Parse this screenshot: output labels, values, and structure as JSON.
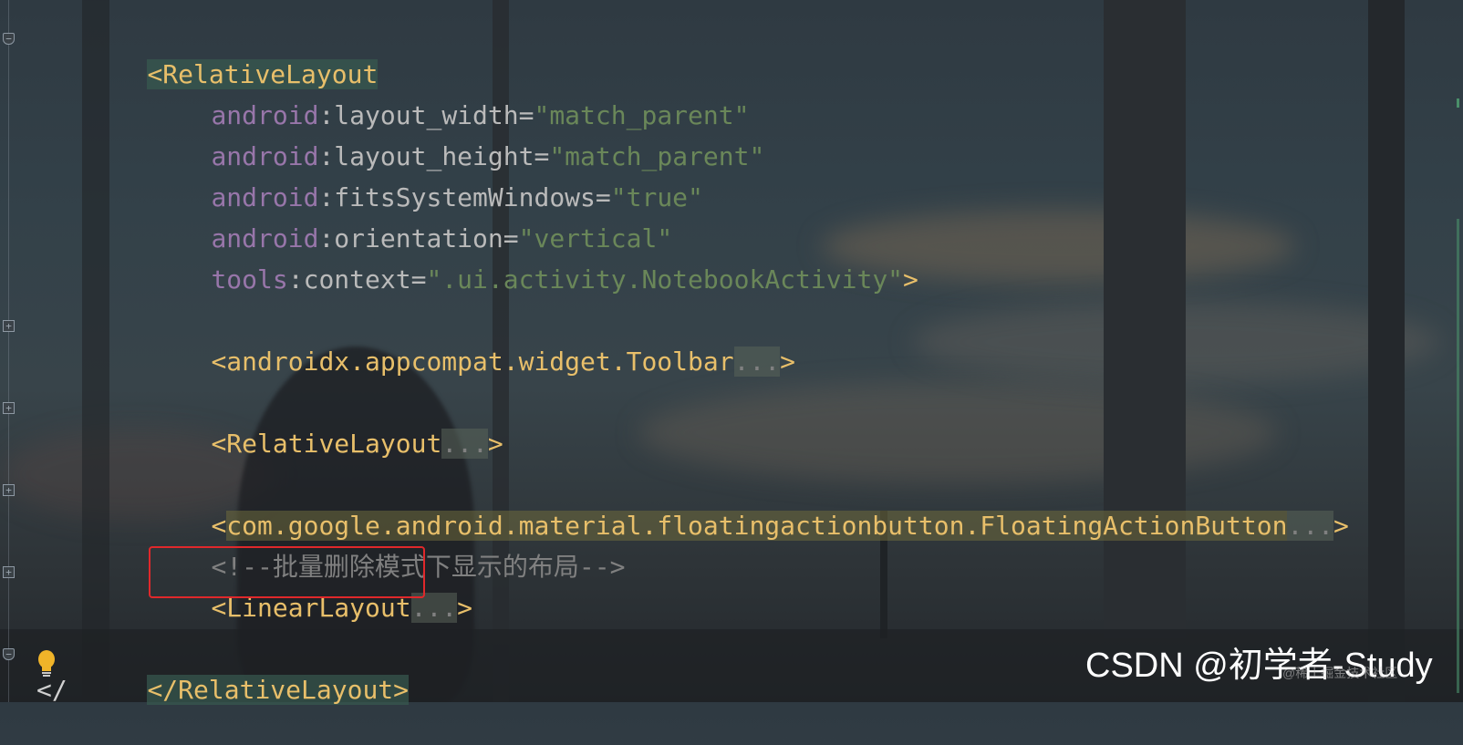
{
  "editor": {
    "lines": [
      {
        "id": "l1",
        "parts": [
          {
            "t": "<",
            "c": "tag"
          },
          {
            "t": "RelativeLayout",
            "c": "tag"
          }
        ]
      },
      {
        "id": "l2",
        "parts": [
          {
            "t": "android",
            "c": "ns"
          },
          {
            "t": ":layout_width",
            "c": "attr"
          },
          {
            "t": "=",
            "c": "attr"
          },
          {
            "t": "\"match_parent\"",
            "c": "val"
          }
        ]
      },
      {
        "id": "l3",
        "parts": [
          {
            "t": "android",
            "c": "ns"
          },
          {
            "t": ":layout_height",
            "c": "attr"
          },
          {
            "t": "=",
            "c": "attr"
          },
          {
            "t": "\"match_parent\"",
            "c": "val"
          }
        ]
      },
      {
        "id": "l4",
        "parts": [
          {
            "t": "android",
            "c": "ns"
          },
          {
            "t": ":fitsSystemWindows",
            "c": "attr"
          },
          {
            "t": "=",
            "c": "attr"
          },
          {
            "t": "\"true\"",
            "c": "val"
          }
        ]
      },
      {
        "id": "l5",
        "parts": [
          {
            "t": "android",
            "c": "ns"
          },
          {
            "t": ":orientation",
            "c": "attr"
          },
          {
            "t": "=",
            "c": "attr"
          },
          {
            "t": "\"vertical\"",
            "c": "val"
          }
        ]
      },
      {
        "id": "l6",
        "parts": [
          {
            "t": "tools",
            "c": "ns"
          },
          {
            "t": ":context",
            "c": "attr"
          },
          {
            "t": "=",
            "c": "attr"
          },
          {
            "t": "\".ui.activity.NotebookActivity\"",
            "c": "val"
          },
          {
            "t": ">",
            "c": "tag"
          }
        ]
      },
      {
        "id": "l7",
        "parts": [
          {
            "t": "<androidx.appcompat.widget.Toolbar",
            "c": "tag"
          },
          {
            "t": "...",
            "c": "dots"
          },
          {
            "t": ">",
            "c": "tag"
          }
        ]
      },
      {
        "id": "l8",
        "parts": [
          {
            "t": "<RelativeLayout",
            "c": "tag"
          },
          {
            "t": "...",
            "c": "dots"
          },
          {
            "t": ">",
            "c": "tag"
          }
        ]
      },
      {
        "id": "l9",
        "parts": [
          {
            "t": "<",
            "c": "tag"
          },
          {
            "t": "com.google.android.material.floatingactionbutton.FloatingActionButton",
            "c": "tag hlb"
          },
          {
            "t": "...",
            "c": "dots"
          },
          {
            "t": ">",
            "c": "tag"
          }
        ]
      },
      {
        "id": "l10",
        "parts": [
          {
            "t": "<!--批量删除模式下显示的布局-->",
            "c": "comment"
          }
        ]
      },
      {
        "id": "l11",
        "parts": [
          {
            "t": "<LinearLayout",
            "c": "tag"
          },
          {
            "t": "...",
            "c": "dots"
          },
          {
            "t": ">",
            "c": "tag"
          }
        ]
      },
      {
        "id": "l12",
        "parts": [
          {
            "t": "</RelativeLayout>",
            "c": "tag hl"
          }
        ]
      }
    ],
    "partial_line": "</"
  },
  "gutter": {
    "fold_collapsed": "+",
    "fold_open": "−"
  },
  "watermark": {
    "main": "CSDN @初学者-Study",
    "sub": "@稀土掘金技术社区"
  },
  "colors": {
    "tag": "#e8bf6a",
    "namespace": "#9876aa",
    "attribute": "#bababa",
    "value": "#6a8759",
    "comment": "#808080",
    "highlight_box": "#e0282b"
  }
}
